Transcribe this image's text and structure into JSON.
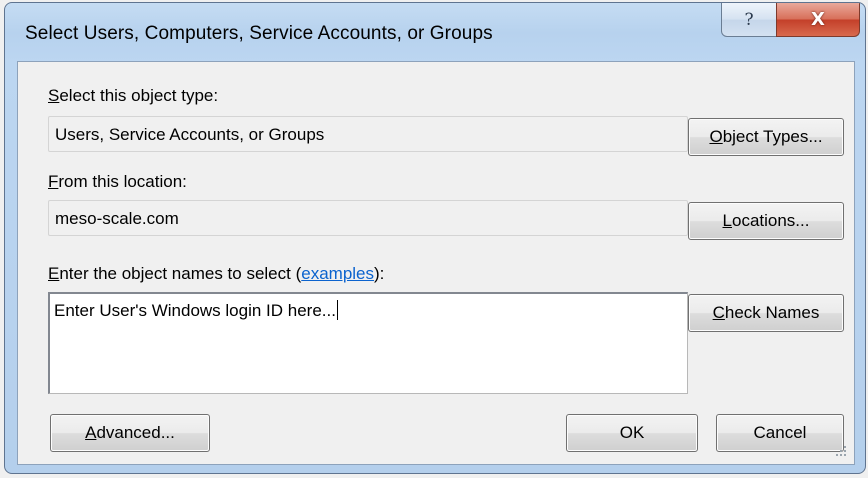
{
  "window": {
    "title": "Select Users, Computers, Service Accounts, or Groups"
  },
  "titlebar": {
    "help_glyph": "?",
    "close_glyph": "X"
  },
  "object_type": {
    "label_key": "S",
    "label_rest": "elect this object type:",
    "value": "Users, Service Accounts, or Groups",
    "button_key": "O",
    "button_rest": "bject Types..."
  },
  "location": {
    "label_key": "F",
    "label_rest": "rom this location:",
    "value": "meso-scale.com",
    "button_key": "L",
    "button_rest": "ocations..."
  },
  "names": {
    "label_key": "E",
    "label_rest": "nter the object names to select (",
    "link": "examples",
    "label_end": "):",
    "value": "Enter User's Windows login ID here...",
    "check_key": "C",
    "check_rest": "heck Names"
  },
  "footer": {
    "advanced_key": "A",
    "advanced_rest": "dvanced...",
    "ok": "OK",
    "cancel": "Cancel"
  },
  "icons": {
    "help": "question-mark-icon",
    "close": "close-x-icon",
    "resize": "resize-grip-icon"
  },
  "colors": {
    "titlebar": "#bcd6f1",
    "close": "#c4402a",
    "link": "#0b63ce",
    "client": "#f0f0f0"
  }
}
